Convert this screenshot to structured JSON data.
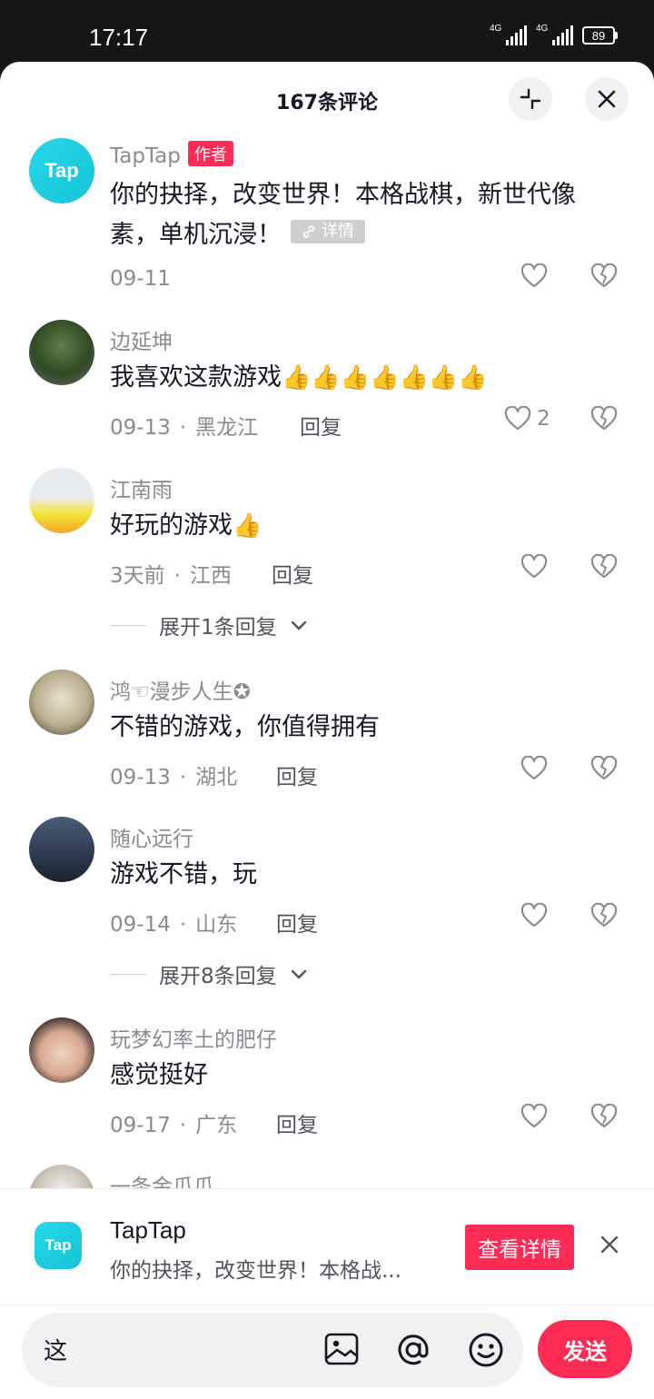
{
  "status_bar": {
    "time": "17:17",
    "sim1": "4G",
    "sim2": "4G",
    "battery": "89"
  },
  "sheet": {
    "title": "167条评论"
  },
  "comments": [
    {
      "user": "TapTap",
      "author_tag": "作者",
      "text": "你的抉择，改变世界！本格战棋，新世代像素，单机沉浸！",
      "detail_tag": "详情",
      "date": "09-11"
    },
    {
      "user": "边延坤",
      "text": "我喜欢这款游戏",
      "date": "09-13",
      "location": "黑龙江",
      "reply": "回复",
      "likes": "2"
    },
    {
      "user": "江南雨",
      "text": "好玩的游戏",
      "date": "3天前",
      "location": "江西",
      "reply": "回复",
      "expand": "展开1条回复"
    },
    {
      "user": "鸿☜漫步人生✪",
      "text": "不错的游戏，你值得拥有",
      "date": "09-13",
      "location": "湖北",
      "reply": "回复"
    },
    {
      "user": "随心远行",
      "text": "游戏不错，玩",
      "date": "09-14",
      "location": "山东",
      "reply": "回复",
      "expand": "展开8条回复"
    },
    {
      "user": "玩梦幻率土的肥仔",
      "text": "感觉挺好",
      "date": "09-17",
      "location": "广东",
      "reply": "回复"
    },
    {
      "user": "一条金瓜瓜"
    }
  ],
  "promo": {
    "logo_text": "Tap",
    "title": "TapTap",
    "desc": "你的抉择，改变世界！本格战...",
    "button": "查看详情"
  },
  "input_bar": {
    "text": "这",
    "send": "发送"
  },
  "colors": {
    "accent": "#fe2c55",
    "meta": "#8a8b91",
    "tap": "#1ccbe0"
  }
}
